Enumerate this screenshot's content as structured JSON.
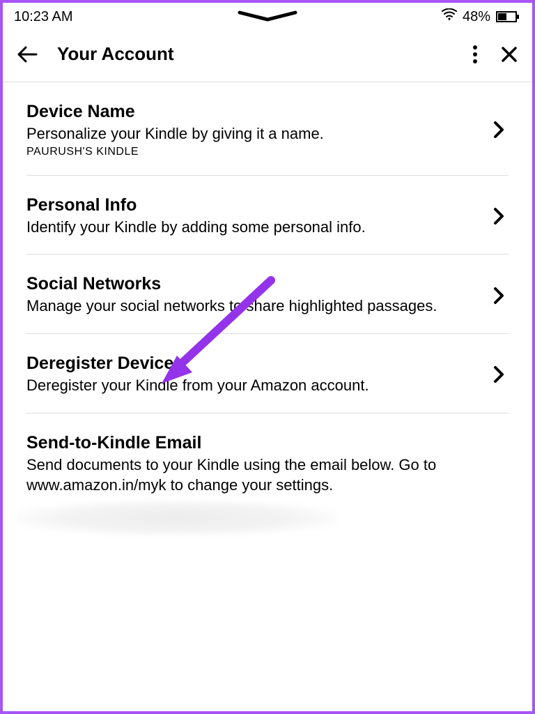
{
  "status": {
    "time": "10:23 AM",
    "battery_percent": "48%"
  },
  "header": {
    "title": "Your Account"
  },
  "items": [
    {
      "title": "Device Name",
      "desc": "Personalize your Kindle by giving it a name.",
      "subtext": "PAURUSH'S KINDLE",
      "chevron": true
    },
    {
      "title": "Personal Info",
      "desc": "Identify your Kindle by adding some personal info.",
      "subtext": "",
      "chevron": true
    },
    {
      "title": "Social Networks",
      "desc": "Manage your social networks to share highlighted passages.",
      "subtext": "",
      "chevron": true
    },
    {
      "title": "Deregister Device",
      "desc": "Deregister your Kindle from your Amazon account.",
      "subtext": "",
      "chevron": true
    },
    {
      "title": "Send-to-Kindle Email",
      "desc": "Send documents to your Kindle using the email below. Go to www.amazon.in/myk to change your settings.",
      "subtext": "",
      "chevron": false
    }
  ],
  "annotation": {
    "arrow_color": "#9333ea"
  }
}
